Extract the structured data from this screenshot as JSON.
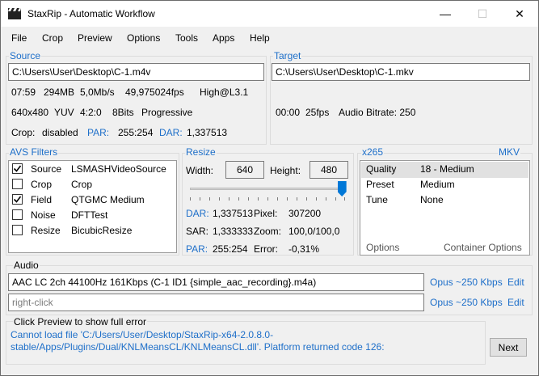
{
  "window": {
    "title": "StaxRip - Automatic Workflow",
    "minimize_glyph": "—",
    "maximize_glyph": "☐",
    "close_glyph": "✕",
    "icon": "clapperboard-icon"
  },
  "menu": [
    "File",
    "Crop",
    "Preview",
    "Options",
    "Tools",
    "Apps",
    "Help"
  ],
  "source": {
    "label": "Source",
    "path": "C:\\Users\\User\\Desktop\\C-1.m4v",
    "duration": "07:59",
    "size": "294MB",
    "bitrate": "5,0Mb/s",
    "fps": "49,975024fps",
    "profile": "High@L3.1",
    "resolution": "640x480",
    "colorspace": "YUV",
    "chroma": "4:2:0",
    "bits": "8Bits",
    "scan": "Progressive",
    "crop_label": "Crop:",
    "crop_value": "disabled",
    "par_label": "PAR:",
    "par_value": "255:254",
    "dar_label": "DAR:",
    "dar_value": "1,337513"
  },
  "target": {
    "label": "Target",
    "path": "C:\\Users\\User\\Desktop\\C-1.mkv",
    "duration": "00:00",
    "fps": "25fps",
    "audio_bitrate": "Audio Bitrate: 250"
  },
  "avs_filters": {
    "label": "AVS Filters",
    "items": [
      {
        "checked": true,
        "name": "Source",
        "value": "LSMASHVideoSource"
      },
      {
        "checked": false,
        "name": "Crop",
        "value": "Crop"
      },
      {
        "checked": true,
        "name": "Field",
        "value": "QTGMC Medium"
      },
      {
        "checked": false,
        "name": "Noise",
        "value": "DFTTest"
      },
      {
        "checked": false,
        "name": "Resize",
        "value": "BicubicResize"
      }
    ]
  },
  "resize": {
    "label": "Resize",
    "width_label": "Width:",
    "width_value": "640",
    "height_label": "Height:",
    "height_value": "480",
    "slider_level": 0.98,
    "dar_label": "DAR:",
    "dar_value": "1,337513",
    "pixel_label": "Pixel:",
    "pixel_value": "307200",
    "sar_label": "SAR:",
    "sar_value": "1,333333",
    "zoom_label": "Zoom:",
    "zoom_value": "100,0/100,0",
    "par_label": "PAR:",
    "par_value": "255:254",
    "error_label": "Error:",
    "error_value": "-0,31%"
  },
  "encoder": {
    "label": "x265",
    "container_label": "MKV",
    "rows": [
      {
        "name": "Quality",
        "value": "18 - Medium"
      },
      {
        "name": "Preset",
        "value": "Medium"
      },
      {
        "name": "Tune",
        "value": "None"
      }
    ],
    "options_link": "Options",
    "container_options_link": "Container Options"
  },
  "audio": {
    "label": "Audio",
    "track1": "AAC LC 2ch 44100Hz 161Kbps (C-1 ID1 {simple_aac_recording}.m4a)",
    "track1_codec": "Opus ~250 Kbps",
    "track2": "right-click",
    "track2_codec": "Opus ~250 Kbps",
    "edit_label": "Edit"
  },
  "status": {
    "label": "Click Preview to show full error",
    "error": "Cannot load file 'C:/Users/User/Desktop/StaxRip-x64-2.0.8.0-stable/Apps/Plugins/Dual/KNLMeansCL/KNLMeansCL.dll'. Platform returned code 126:",
    "next_label": "Next"
  },
  "colors": {
    "accent": "#1e6fc9",
    "slider_thumb": "#0078d7"
  }
}
